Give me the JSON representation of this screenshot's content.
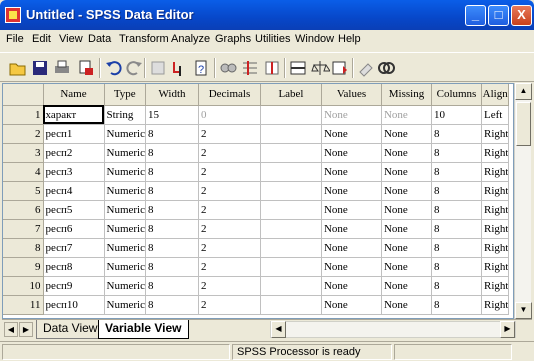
{
  "window": {
    "title": "Untitled - SPSS Data Editor",
    "minimize": "_",
    "maximize": "□",
    "close": "X"
  },
  "menu": [
    "File",
    "Edit",
    "View",
    "Data",
    "Transform",
    "Analyze",
    "Graphs",
    "Utilities",
    "Window",
    "Help"
  ],
  "toolbar": [
    "open-icon",
    "save-icon",
    "print-icon",
    "dialog-recall-icon",
    "undo-icon",
    "redo-icon",
    "goto-chart-icon",
    "goto-case-icon",
    "variables-icon",
    "find-icon",
    "insert-cases-icon",
    "insert-variable-icon",
    "split-file-icon",
    "weight-cases-icon",
    "select-cases-icon",
    "value-labels-icon",
    "use-sets-icon"
  ],
  "grid": {
    "headers": [
      "Name",
      "Type",
      "Width",
      "Decimals",
      "Label",
      "Values",
      "Missing",
      "Columns",
      "Align"
    ],
    "rows": [
      {
        "n": "1",
        "name": "характ",
        "type": "String",
        "width": "15",
        "decimals": "0",
        "label": "",
        "values": "None",
        "missing": "None",
        "columns": "10",
        "align": "Left"
      },
      {
        "n": "2",
        "name": "респ1",
        "type": "Numeric",
        "width": "8",
        "decimals": "2",
        "label": "",
        "values": "None",
        "missing": "None",
        "columns": "8",
        "align": "Right"
      },
      {
        "n": "3",
        "name": "респ2",
        "type": "Numeric",
        "width": "8",
        "decimals": "2",
        "label": "",
        "values": "None",
        "missing": "None",
        "columns": "8",
        "align": "Right"
      },
      {
        "n": "4",
        "name": "респ3",
        "type": "Numeric",
        "width": "8",
        "decimals": "2",
        "label": "",
        "values": "None",
        "missing": "None",
        "columns": "8",
        "align": "Right"
      },
      {
        "n": "5",
        "name": "респ4",
        "type": "Numeric",
        "width": "8",
        "decimals": "2",
        "label": "",
        "values": "None",
        "missing": "None",
        "columns": "8",
        "align": "Right"
      },
      {
        "n": "6",
        "name": "респ5",
        "type": "Numeric",
        "width": "8",
        "decimals": "2",
        "label": "",
        "values": "None",
        "missing": "None",
        "columns": "8",
        "align": "Right"
      },
      {
        "n": "7",
        "name": "респ6",
        "type": "Numeric",
        "width": "8",
        "decimals": "2",
        "label": "",
        "values": "None",
        "missing": "None",
        "columns": "8",
        "align": "Right"
      },
      {
        "n": "8",
        "name": "респ7",
        "type": "Numeric",
        "width": "8",
        "decimals": "2",
        "label": "",
        "values": "None",
        "missing": "None",
        "columns": "8",
        "align": "Right"
      },
      {
        "n": "9",
        "name": "респ8",
        "type": "Numeric",
        "width": "8",
        "decimals": "2",
        "label": "",
        "values": "None",
        "missing": "None",
        "columns": "8",
        "align": "Right"
      },
      {
        "n": "10",
        "name": "респ9",
        "type": "Numeric",
        "width": "8",
        "decimals": "2",
        "label": "",
        "values": "None",
        "missing": "None",
        "columns": "8",
        "align": "Right"
      },
      {
        "n": "11",
        "name": "респ10",
        "type": "Numeric",
        "width": "8",
        "decimals": "2",
        "label": "",
        "values": "None",
        "missing": "None",
        "columns": "8",
        "align": "Right"
      }
    ]
  },
  "tabs": {
    "data_view": "Data View",
    "variable_view": "Variable View"
  },
  "status": {
    "processor": "SPSS Processor  is ready"
  }
}
